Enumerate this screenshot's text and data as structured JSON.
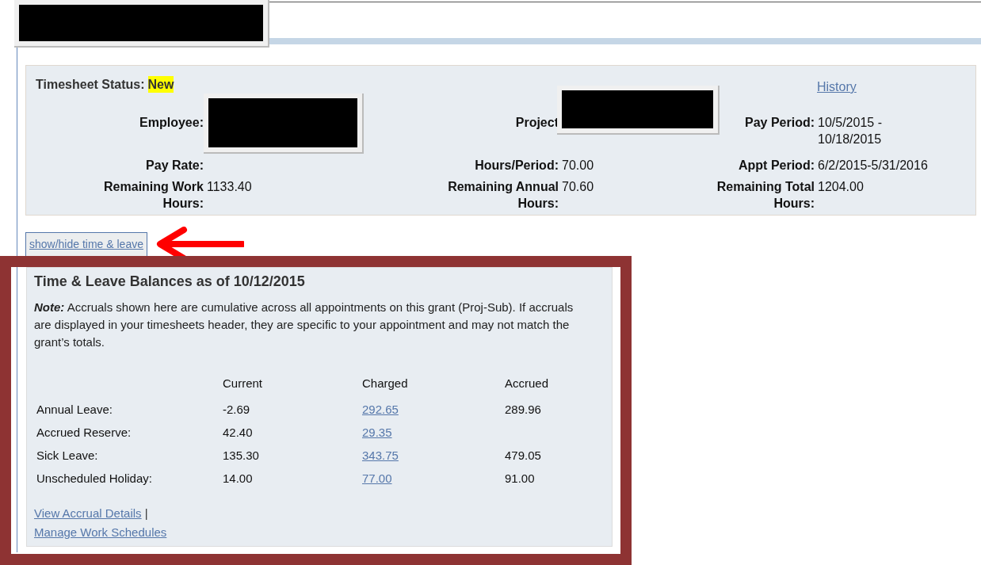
{
  "status_panel": {
    "status_label": "Timesheet Status:",
    "status": "New",
    "history_link": "History",
    "field_rows": [
      [
        {
          "label": "Employee:",
          "redacted": true
        },
        {
          "label": "Project",
          "redacted": true
        },
        {
          "label": "Pay Period:",
          "value": "10/5/2015 - 10/18/2015"
        }
      ],
      [
        {
          "label": "Pay Rate:"
        },
        {
          "label": "Hours/Period:",
          "value": "70.00"
        },
        {
          "label": "Appt Period:",
          "value": "6/2/2015-5/31/2016"
        }
      ],
      [
        {
          "label": "Remaining Work Hours:",
          "value": "1133.40"
        },
        {
          "label": "Remaining Annual Hours:",
          "value": "70.60"
        },
        {
          "label": "Remaining Total Hours:",
          "value": "1204.00"
        }
      ]
    ]
  },
  "toggle_link": "show/hide time & leave",
  "balances": {
    "title": "Time & Leave Balances as of 10/12/2015",
    "note": "**Note:** Accruals shown here are cumulative across all appointments on this grant (Proj-Sub). If accruals are displayed in your timesheets header, they are specific to your appointment and may not match the grant’s totals.",
    "columns": [
      "Current",
      "Charged",
      "Accrued"
    ],
    "rows": [
      {
        "label": "Annual Leave:",
        "current": "-2.69",
        "charged": "292.65",
        "accrued": "289.96"
      },
      {
        "label": "Accrued Reserve:",
        "current": "42.40",
        "charged": "29.35"
      },
      {
        "label": "Sick Leave:",
        "current": "135.30",
        "charged": "343.75",
        "accrued": "479.05"
      },
      {
        "label": "Unscheduled Holiday:",
        "current": "14.00",
        "charged": "77.00",
        "accrued": "91.00"
      }
    ],
    "links": [
      {
        "text": "View Accrual Details",
        "separator": "|"
      },
      {
        "text": "Manage Work Schedules"
      }
    ]
  }
}
